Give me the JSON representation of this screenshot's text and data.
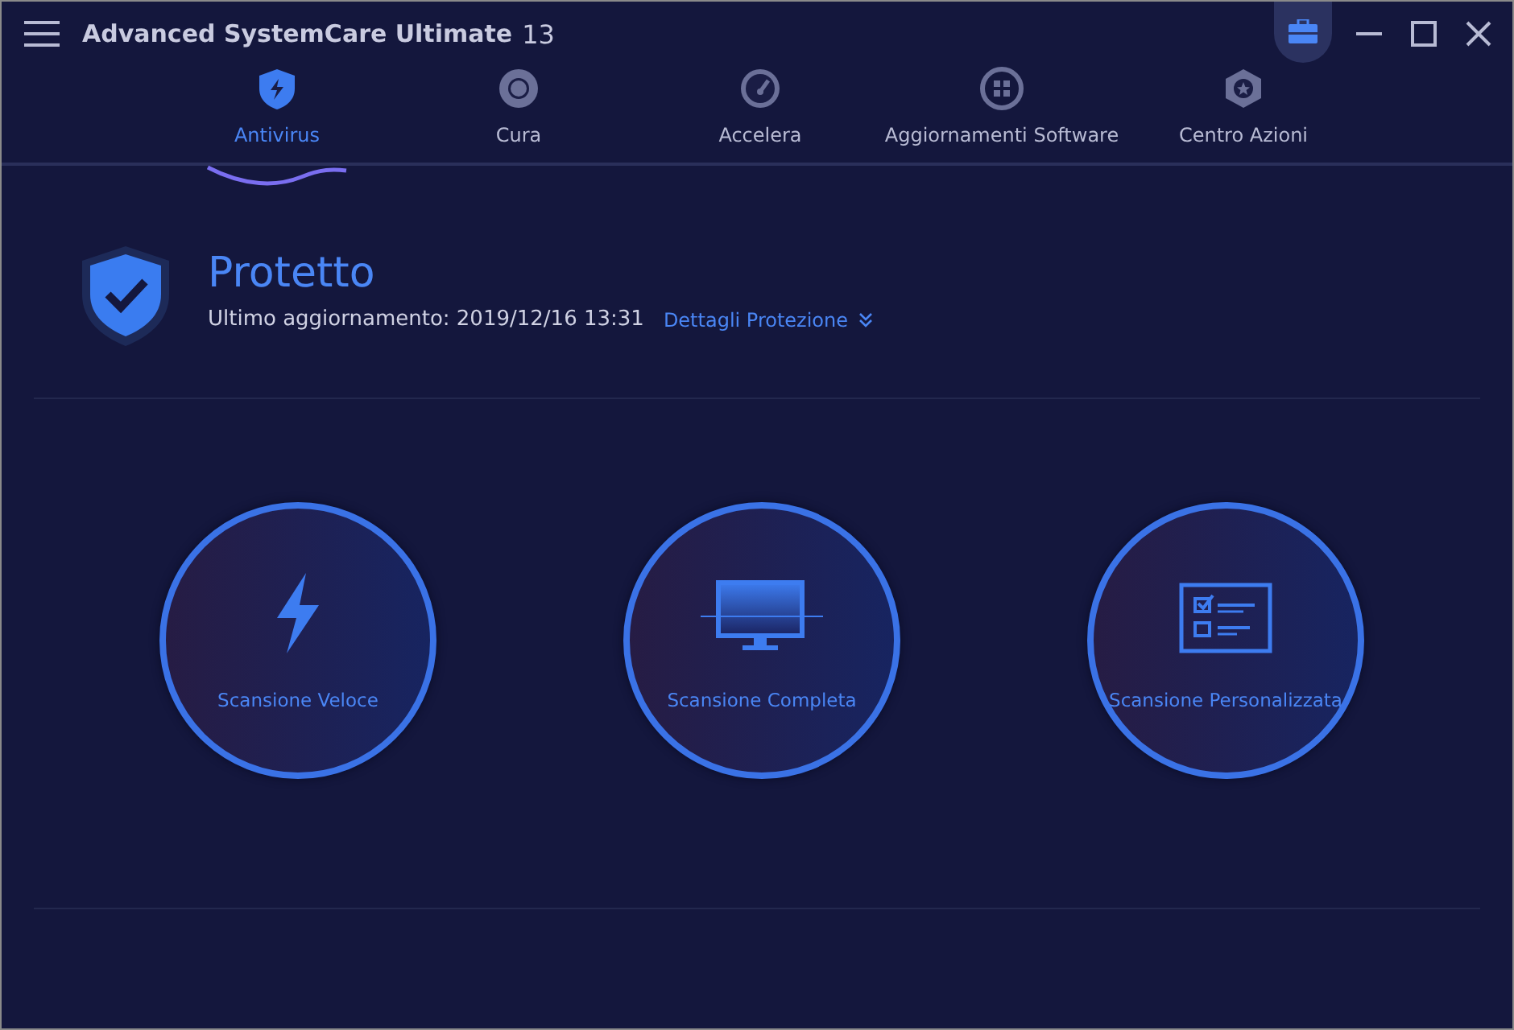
{
  "window": {
    "title": "Advanced SystemCare Ultimate",
    "version": "13"
  },
  "tabs": [
    {
      "label": "Antivirus",
      "kind": "shield",
      "selected": true
    },
    {
      "label": "Cura",
      "kind": "aperture",
      "selected": false
    },
    {
      "label": "Accelera",
      "kind": "gauge",
      "selected": false
    },
    {
      "label": "Aggiornamenti Software",
      "kind": "grid",
      "selected": false
    },
    {
      "label": "Centro Azioni",
      "kind": "hexagon",
      "selected": false
    }
  ],
  "status": {
    "title": "Protetto",
    "last_update": "Ultimo aggiornamento: 2019/12/16 13:31",
    "details_link": "Dettagli Protezione"
  },
  "scans": [
    {
      "label": "Scansione Veloce",
      "kind": "bolt"
    },
    {
      "label": "Scansione Completa",
      "kind": "monitor"
    },
    {
      "label": "Scansione Personalizzata",
      "kind": "checklist"
    }
  ]
}
